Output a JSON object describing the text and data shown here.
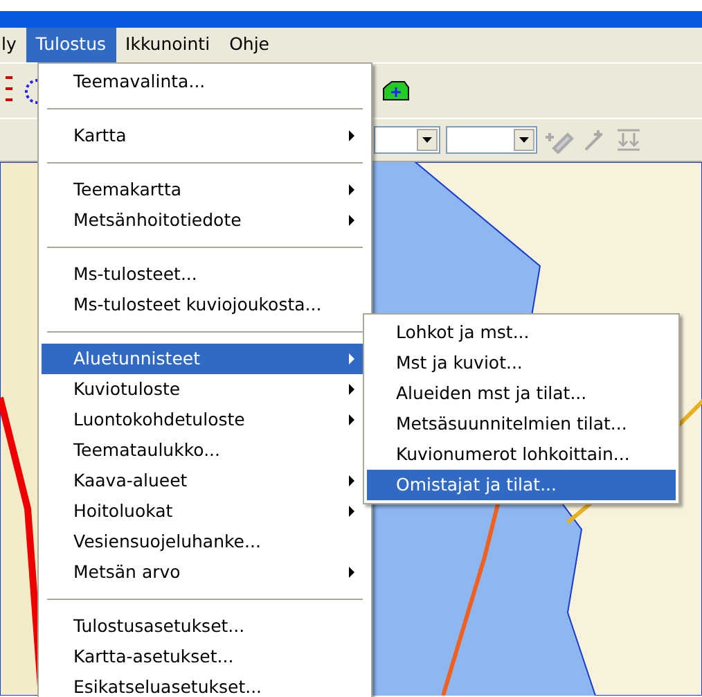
{
  "menubar": [
    {
      "label": "ly",
      "selected": false
    },
    {
      "label": "Tulostus",
      "selected": true
    },
    {
      "label": "Ikkunointi",
      "selected": false
    },
    {
      "label": "Ohje",
      "selected": false
    }
  ],
  "menu": {
    "items": [
      {
        "kind": "item",
        "label": "Teemavalinta...",
        "submenu": false,
        "selected": false
      },
      {
        "kind": "separator"
      },
      {
        "kind": "item",
        "label": "Kartta",
        "submenu": true,
        "selected": false
      },
      {
        "kind": "separator"
      },
      {
        "kind": "item",
        "label": "Teemakartta",
        "submenu": true,
        "selected": false
      },
      {
        "kind": "item",
        "label": "Metsänhoitotiedote",
        "submenu": true,
        "selected": false
      },
      {
        "kind": "separator"
      },
      {
        "kind": "item",
        "label": "Ms-tulosteet...",
        "submenu": false,
        "selected": false
      },
      {
        "kind": "item",
        "label": "Ms-tulosteet kuviojoukosta...",
        "submenu": false,
        "selected": false
      },
      {
        "kind": "separator"
      },
      {
        "kind": "item",
        "label": "Aluetunnisteet",
        "submenu": true,
        "selected": true
      },
      {
        "kind": "item",
        "label": "Kuviotuloste",
        "submenu": true,
        "selected": false
      },
      {
        "kind": "item",
        "label": "Luontokohdetuloste",
        "submenu": true,
        "selected": false
      },
      {
        "kind": "item",
        "label": "Teemataulukko...",
        "submenu": false,
        "selected": false
      },
      {
        "kind": "item",
        "label": "Kaava-alueet",
        "submenu": true,
        "selected": false
      },
      {
        "kind": "item",
        "label": "Hoitoluokat",
        "submenu": true,
        "selected": false
      },
      {
        "kind": "item",
        "label": "Vesiensuojeluhanke...",
        "submenu": false,
        "selected": false
      },
      {
        "kind": "item",
        "label": "Metsän arvo",
        "submenu": true,
        "selected": false
      },
      {
        "kind": "separator"
      },
      {
        "kind": "item",
        "label": "Tulostusasetukset...",
        "submenu": false,
        "selected": false
      },
      {
        "kind": "item",
        "label": "Kartta-asetukset...",
        "submenu": false,
        "selected": false
      },
      {
        "kind": "item",
        "label": "Esikatseluasetukset...",
        "submenu": false,
        "selected": false
      }
    ]
  },
  "submenu": {
    "items": [
      {
        "label": "Lohkot ja mst...",
        "selected": false
      },
      {
        "label": "Mst ja kuviot...",
        "selected": false
      },
      {
        "label": "Alueiden mst ja tilat...",
        "selected": false
      },
      {
        "label": "Metsäsuunnitelmien tilat...",
        "selected": false
      },
      {
        "label": "Kuvionumerot lohkoittain...",
        "selected": false
      },
      {
        "label": "Omistajat ja tilat...",
        "selected": true
      }
    ]
  }
}
